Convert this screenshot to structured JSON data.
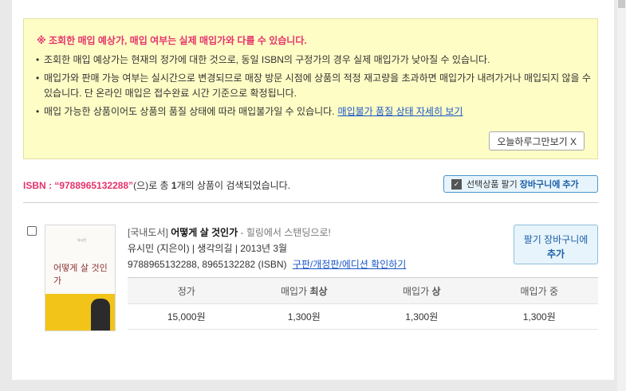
{
  "notice": {
    "title": "※ 조회한 매입 예상가, 매입 여부는 실제 매입가와 다를 수 있습니다.",
    "items": [
      "조회한 매입 예상가는 현재의 정가에 대한 것으로, 동일 ISBN의 구정가의 경우 실제 매입가가 낮아질 수 있습니다.",
      "매입가와 판매 가능 여부는 실시간으로 변경되므로 매장 방문 시점에 상품의 적정 재고량을 초과하면 매입가가 내려가거나 매입되지 않을 수 있습니다. 단 온라인 매입은 접수완료 시간 기준으로 확정됩니다.",
      "매입 가능한 상품이어도 상품의 품질 상태에 따라 매입불가일 수 있습니다."
    ],
    "link_label": "매입불가 품질 상태 자세히 보기",
    "hide_today_label": "오늘하루그만보기 X"
  },
  "result": {
    "isbn_label": "ISBN : “9788965132288”",
    "text_before": "(으)로 총 ",
    "count": "1",
    "text_after": "개의 상품이 검색되었습니다.",
    "add_selected_label": "선택상품 팔기",
    "add_selected_bold": "장바구니에 추가"
  },
  "product": {
    "category": "[국내도서]",
    "title": "어떻게 살 것인가",
    "subtitle": "- 힐링에서 스탠딩으로!",
    "author_line": "유시민 (지은이) | 생각의길 | 2013년 3월",
    "isbn_line": "9788965132288, 8965132282 (ISBN)",
    "edition_link": "구판/개정판/에디션 확인하기",
    "cover_title": "어떻게 살 것인가",
    "add_cart_label": "팔기 장바구니에",
    "add_cart_bold": "추가"
  },
  "price_table": {
    "headers": [
      "정가",
      "매입가 최상",
      "매입가 상",
      "매입가 중"
    ],
    "values": [
      "15,000원",
      "1,300원",
      "1,300원",
      "1,300원"
    ]
  }
}
